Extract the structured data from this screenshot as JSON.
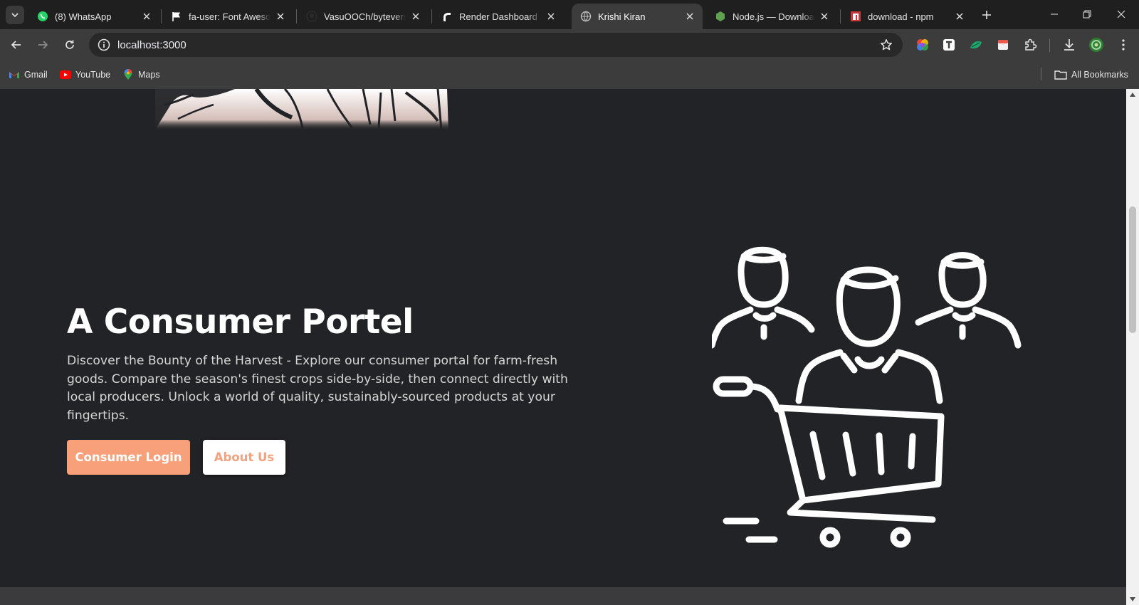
{
  "browser": {
    "tabs": [
      {
        "title": "(8) WhatsApp",
        "icon": "whatsapp-icon",
        "active": false
      },
      {
        "title": "fa-user: Font Awesome",
        "icon": "flag-icon",
        "active": false
      },
      {
        "title": "VasuOOCh/byteverse",
        "icon": "github-icon",
        "active": false
      },
      {
        "title": "Render Dashboard",
        "icon": "render-icon",
        "active": false
      },
      {
        "title": "Krishi Kiran",
        "icon": "globe-icon",
        "active": true
      },
      {
        "title": "Node.js — Download",
        "icon": "nodejs-icon",
        "active": false
      },
      {
        "title": "download - npm",
        "icon": "npm-icon",
        "active": false
      }
    ],
    "url": "localhost:3000",
    "bookmarks": [
      {
        "label": "Gmail",
        "icon": "gmail-icon"
      },
      {
        "label": "YouTube",
        "icon": "youtube-icon"
      },
      {
        "label": "Maps",
        "icon": "maps-icon"
      }
    ],
    "all_bookmarks_label": "All Bookmarks"
  },
  "hero": {
    "title": "A Consumer Portel",
    "description": "Discover the Bounty of the Harvest - Explore our consumer portal for farm-fresh goods. Compare the season's finest crops side-by-side, then connect directly with local producers. Unlock a world of quality, sustainably-sourced products at your fingertips.",
    "primary_button": "Consumer Login",
    "secondary_button": "About Us"
  },
  "colors": {
    "page_bg": "#222326",
    "accent": "#f8a07a",
    "text": "#ffffff"
  }
}
